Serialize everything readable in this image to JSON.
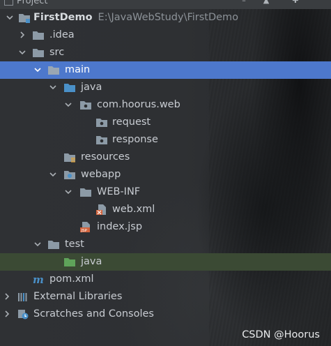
{
  "panel": {
    "title": "Project"
  },
  "tree": {
    "root": {
      "name": "FirstDemo",
      "path": "E:\\JavaWebStudy\\FirstDemo"
    },
    "idea": ".idea",
    "src": "src",
    "main": "main",
    "java": "java",
    "package": "com.hoorus.web",
    "request": "request",
    "response": "response",
    "resources": "resources",
    "webapp": "webapp",
    "webinf": "WEB-INF",
    "webxml": "web.xml",
    "indexjsp": "index.jsp",
    "test": "test",
    "testjava": "java",
    "pom": "pom.xml",
    "extlibs": "External Libraries",
    "scratches": "Scratches and Consoles"
  },
  "watermark": "CSDN @Hoorus",
  "colors": {
    "selection": "#4d78cc",
    "highlight_row": "#3b4a34",
    "folder": "#8c9aa6",
    "source_folder": "#4a90c8",
    "test_folder": "#5fa35a"
  }
}
